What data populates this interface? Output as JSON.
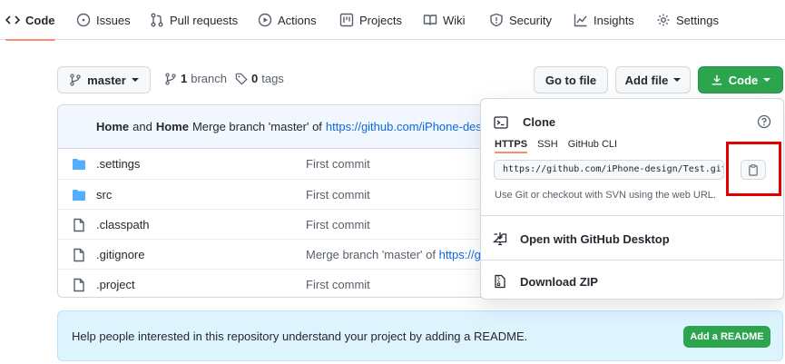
{
  "nav": {
    "tabs": [
      {
        "label": "Code",
        "icon": "code-icon"
      },
      {
        "label": "Issues",
        "icon": "issue-icon"
      },
      {
        "label": "Pull requests",
        "icon": "pull-request-icon"
      },
      {
        "label": "Actions",
        "icon": "play-icon"
      },
      {
        "label": "Projects",
        "icon": "project-icon"
      },
      {
        "label": "Wiki",
        "icon": "book-icon"
      },
      {
        "label": "Security",
        "icon": "shield-icon"
      },
      {
        "label": "Insights",
        "icon": "graph-icon"
      },
      {
        "label": "Settings",
        "icon": "gear-icon"
      }
    ],
    "active": "Code"
  },
  "toolbar": {
    "branch": "master",
    "branch_count": "1",
    "branch_label": "branch",
    "tag_count": "0",
    "tag_label": "tags",
    "go_to_file": "Go to file",
    "add_file": "Add file",
    "code": "Code"
  },
  "commit": {
    "author1": "Home",
    "and": "and",
    "author2": "Home",
    "message": "Merge branch 'master' of",
    "link": "https://github.com/iPhone-design"
  },
  "files": [
    {
      "name": ".settings",
      "type": "folder",
      "message": "First commit",
      "link": ""
    },
    {
      "name": "src",
      "type": "folder",
      "message": "First commit",
      "link": ""
    },
    {
      "name": ".classpath",
      "type": "file",
      "message": "First commit",
      "link": ""
    },
    {
      "name": ".gitignore",
      "type": "file",
      "message": "Merge branch 'master' of",
      "link": "https://gi"
    },
    {
      "name": ".project",
      "type": "file",
      "message": "First commit",
      "link": ""
    }
  ],
  "readme": {
    "text": "Help people interested in this repository understand your project by adding a README.",
    "button": "Add a README"
  },
  "clone": {
    "title": "Clone",
    "tabs": [
      "HTTPS",
      "SSH",
      "GitHub CLI"
    ],
    "active_tab": "HTTPS",
    "url": "https://github.com/iPhone-design/Test.git",
    "hint": "Use Git or checkout with SVN using the web URL.",
    "desktop": "Open with GitHub Desktop",
    "zip": "Download ZIP"
  },
  "colors": {
    "accent_green": "#2da44e",
    "link_blue": "#0969da",
    "tab_underline": "#fd8c73",
    "highlight_red": "#e00000"
  }
}
